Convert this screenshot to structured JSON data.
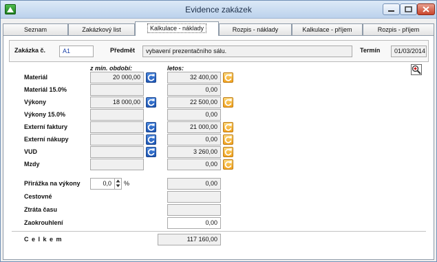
{
  "window": {
    "title": "Evidence zakázek"
  },
  "tabs": [
    "Seznam",
    "Zakázkový list",
    "Kalkulace - náklady",
    "Rozpis - náklady",
    "Kalkulace - příjem",
    "Rozpis - příjem"
  ],
  "header": {
    "order_label": "Zakázka č.",
    "order_value": "A1",
    "subject_label": "Předmět",
    "subject_value": "vybavení prezentačního sálu.",
    "term_label": "Termín",
    "term_value": "01/03/2014"
  },
  "columns": {
    "prev_period": "z min. období:",
    "this_year": "letos:"
  },
  "rows": [
    {
      "label": "Materiál",
      "prev": "20 000,00",
      "curr": "32 400,00"
    },
    {
      "label": "Materiál 15.0%",
      "prev": "",
      "curr": "0,00"
    },
    {
      "label": "Výkony",
      "prev": "18 000,00",
      "curr": "22 500,00"
    },
    {
      "label": "Výkony 15.0%",
      "prev": "",
      "curr": "0,00"
    },
    {
      "label": "Externí faktury",
      "prev": "",
      "curr": "21 000,00"
    },
    {
      "label": "Externí nákupy",
      "prev": "",
      "curr": "0,00"
    },
    {
      "label": "VUD",
      "prev": "",
      "curr": "3 260,00"
    },
    {
      "label": "Mzdy",
      "prev": "",
      "curr": "0,00"
    }
  ],
  "surcharge": {
    "label": "Přirážka na výkony",
    "percent_value": "0,0",
    "unit": "%",
    "amount": "0,00"
  },
  "extra_rows": [
    {
      "label": "Cestovné",
      "value": ""
    },
    {
      "label": "Ztráta času",
      "value": ""
    },
    {
      "label": "Zaokrouhlení",
      "value": "0,00"
    }
  ],
  "total": {
    "label": "C e l k e m",
    "value": "117 160,00"
  },
  "icons": {
    "refresh_prev": "refresh-blue-icon",
    "refresh_curr": "refresh-orange-icon",
    "zoom": "zoom-in-icon"
  }
}
